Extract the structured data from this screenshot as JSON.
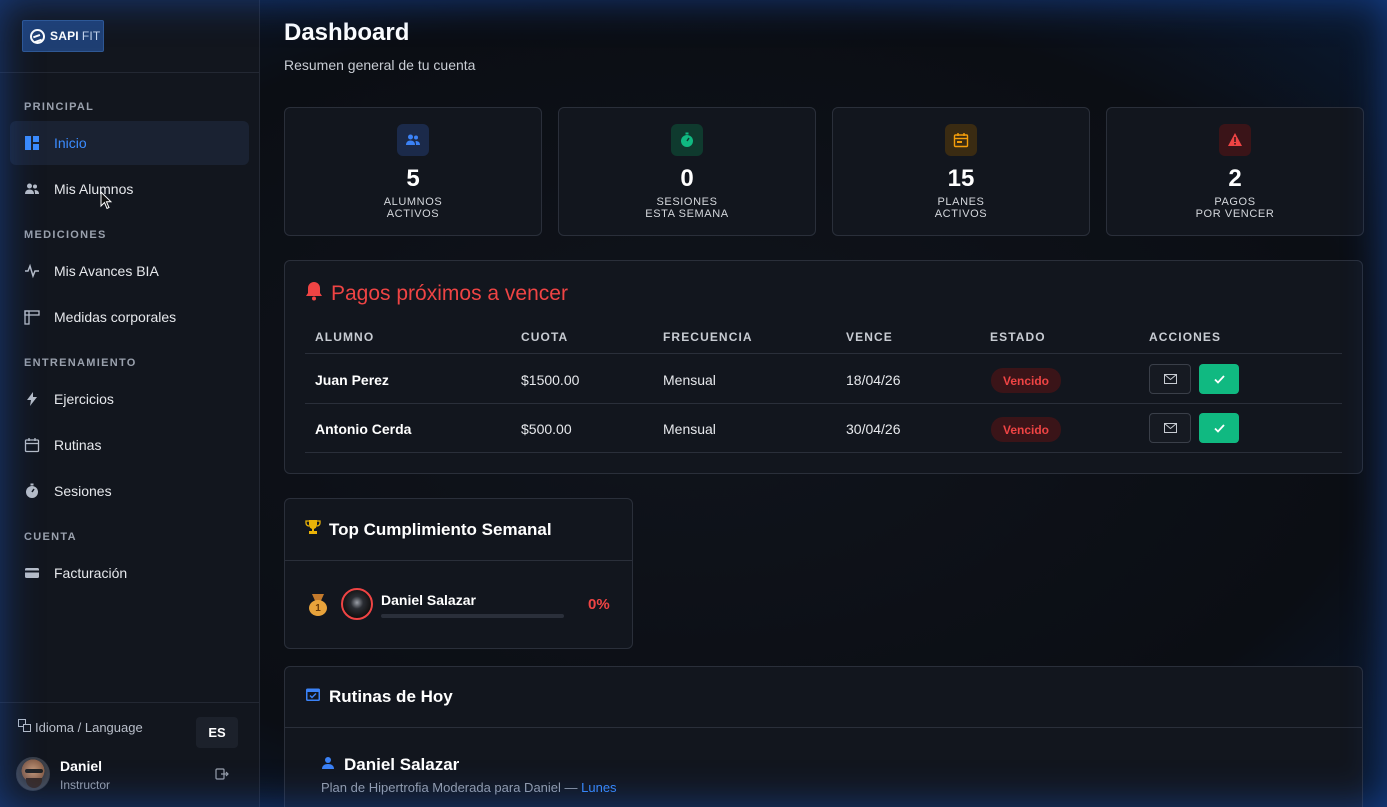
{
  "brand": {
    "name": "SAPI",
    "suffix": "FIT"
  },
  "sidebar": {
    "sections": [
      {
        "title": "PRINCIPAL"
      },
      {
        "title": "MEDICIONES"
      },
      {
        "title": "ENTRENAMIENTO"
      },
      {
        "title": "CUENTA"
      }
    ],
    "items": [
      {
        "label": "Inicio",
        "icon": "dashboard-icon",
        "active": true
      },
      {
        "label": "Mis Alumnos",
        "icon": "users-icon"
      },
      {
        "label": "Mis Avances BIA",
        "icon": "activity-icon"
      },
      {
        "label": "Medidas corporales",
        "icon": "ruler-icon"
      },
      {
        "label": "Ejercicios",
        "icon": "bolt-icon"
      },
      {
        "label": "Rutinas",
        "icon": "calendar-icon"
      },
      {
        "label": "Sesiones",
        "icon": "stopwatch-icon"
      },
      {
        "label": "Facturación",
        "icon": "credit-card-icon"
      }
    ],
    "language": {
      "label": "Idioma / Language",
      "code": "ES"
    },
    "user": {
      "name": "Daniel",
      "role": "Instructor"
    }
  },
  "header": {
    "title": "Dashboard",
    "subtitle": "Resumen general de tu cuenta"
  },
  "stats": [
    {
      "value": "5",
      "line1": "ALUMNOS",
      "line2": "ACTIVOS",
      "icon": "users-icon",
      "color": "#3b82f6",
      "bg": "#1b2a4a"
    },
    {
      "value": "0",
      "line1": "SESIONES",
      "line2": "ESTA SEMANA",
      "icon": "stopwatch-icon",
      "color": "#10b981",
      "bg": "#0f3a2e"
    },
    {
      "value": "15",
      "line1": "PLANES",
      "line2": "ACTIVOS",
      "icon": "calendar-icon",
      "color": "#f59e0b",
      "bg": "#3a2b12"
    },
    {
      "value": "2",
      "line1": "PAGOS",
      "line2": "POR VENCER",
      "icon": "warning-icon",
      "color": "#ef4444",
      "bg": "#3a1418"
    }
  ],
  "payments": {
    "title": "Pagos próximos a vencer",
    "columns": [
      "ALUMNO",
      "CUOTA",
      "FRECUENCIA",
      "VENCE",
      "ESTADO",
      "ACCIONES"
    ],
    "rows": [
      {
        "alumno": "Juan Perez",
        "cuota": "$1500.00",
        "frecuencia": "Mensual",
        "vence": "18/04/26",
        "estado": "Vencido"
      },
      {
        "alumno": "Antonio Cerda",
        "cuota": "$500.00",
        "frecuencia": "Mensual",
        "vence": "30/04/26",
        "estado": "Vencido"
      }
    ]
  },
  "top": {
    "title": "Top Cumplimiento Semanal",
    "entries": [
      {
        "rank": 1,
        "name": "Daniel Salazar",
        "percent": "0%",
        "progress": 0
      }
    ]
  },
  "routines": {
    "title": "Rutinas de Hoy",
    "items": [
      {
        "student": "Daniel Salazar",
        "plan": "Plan de Hipertrofia Moderada para Daniel — ",
        "day": "Lunes"
      }
    ]
  },
  "colors": {
    "accent": "#3b8cff",
    "danger": "#ef4444",
    "success": "#10b981"
  }
}
